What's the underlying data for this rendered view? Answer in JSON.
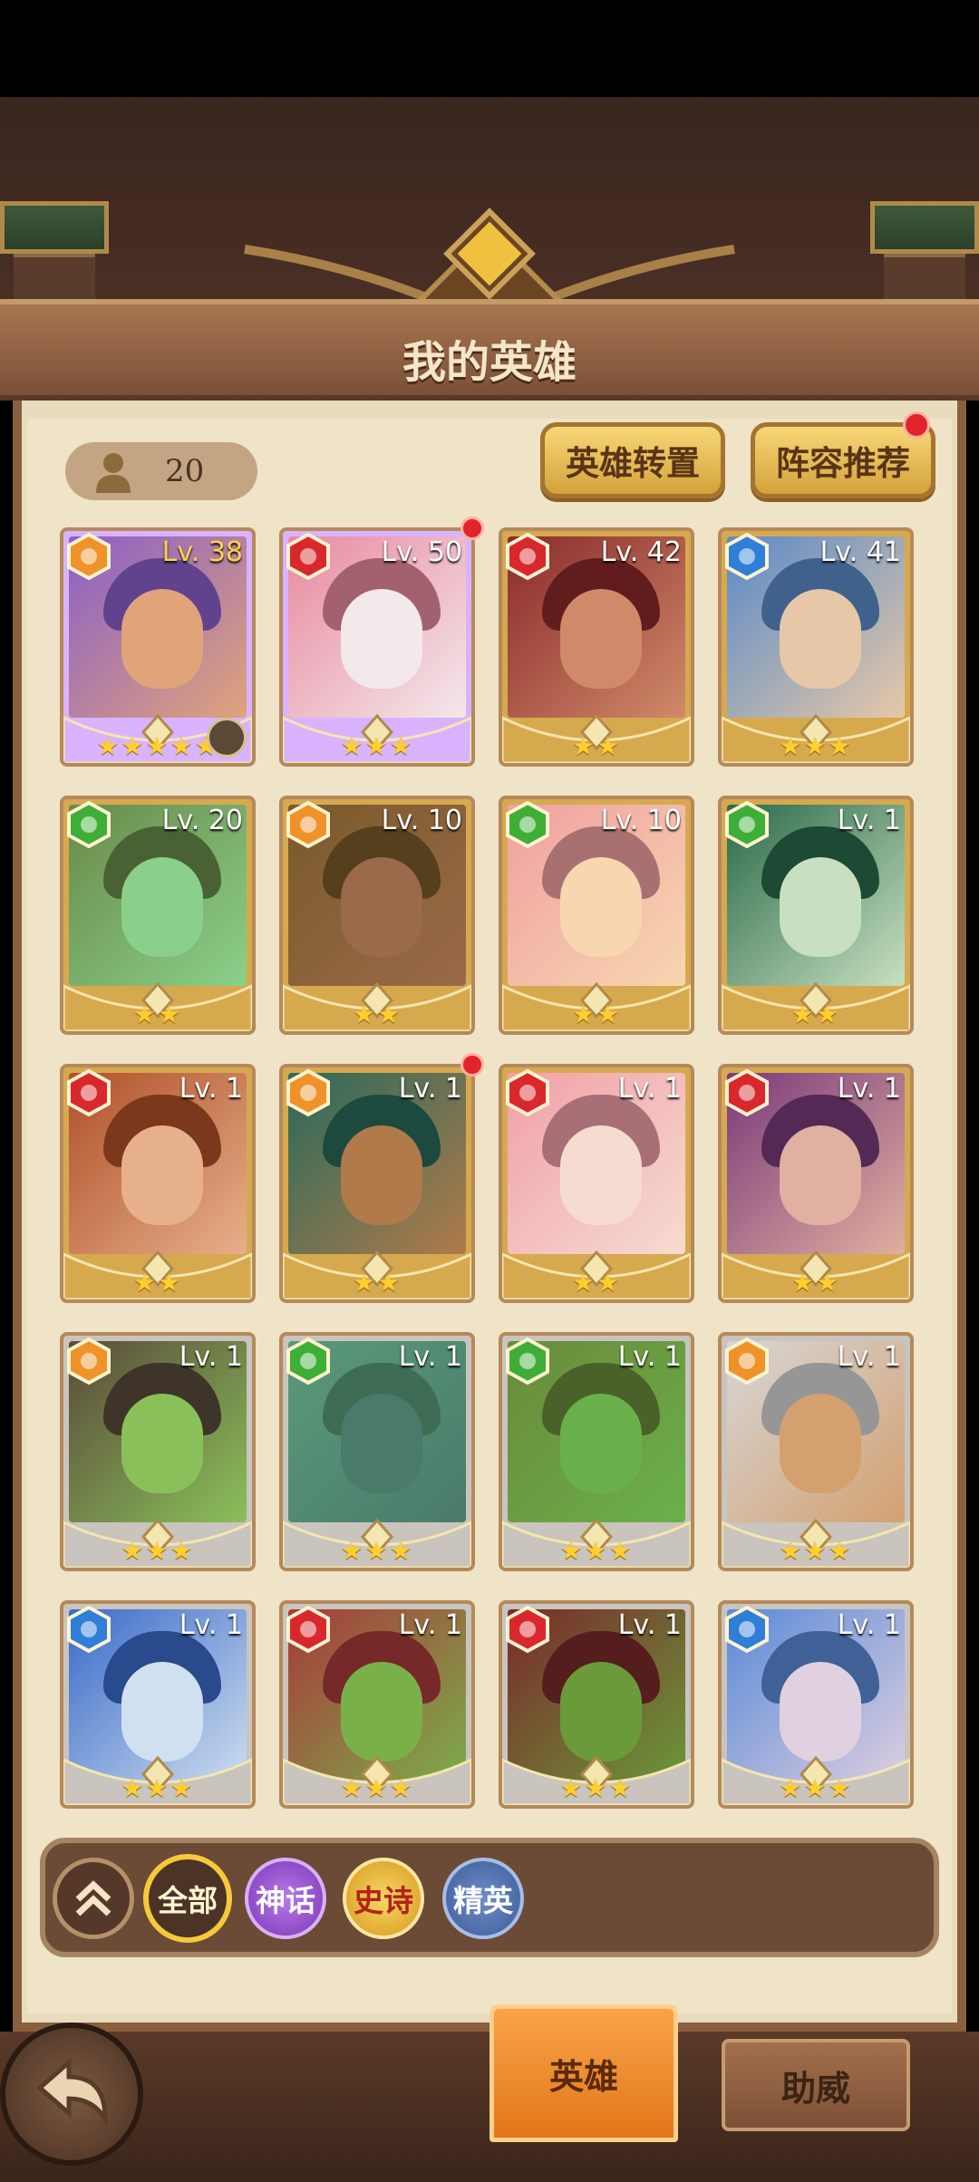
{
  "header": {
    "title": "我的英雄"
  },
  "toolbar": {
    "hero_count": "20",
    "transfer_label": "英雄转置",
    "lineup_label": "阵容推荐"
  },
  "colors": {
    "fire": "#d9282c",
    "light": "#f0922a",
    "nature": "#3fae37",
    "water": "#2f7ed8"
  },
  "heroes": [
    {
      "level": "Lv. 38",
      "element": "light",
      "stars": "★★★★★",
      "tier": "myth"
    },
    {
      "level": "Lv. 50",
      "element": "fire",
      "stars": "★★★",
      "tier": "myth"
    },
    {
      "level": "Lv. 42",
      "element": "fire",
      "stars": "★★",
      "tier": "epic"
    },
    {
      "level": "Lv. 41",
      "element": "water",
      "stars": "★★★",
      "tier": "epic"
    },
    {
      "level": "Lv. 20",
      "element": "nature",
      "stars": "★★",
      "tier": "epic"
    },
    {
      "level": "Lv. 10",
      "element": "light",
      "stars": "★★",
      "tier": "epic"
    },
    {
      "level": "Lv. 10",
      "element": "nature",
      "stars": "★★",
      "tier": "epic"
    },
    {
      "level": "Lv. 1",
      "element": "nature",
      "stars": "★★",
      "tier": "epic"
    },
    {
      "level": "Lv. 1",
      "element": "fire",
      "stars": "★★",
      "tier": "epic"
    },
    {
      "level": "Lv. 1",
      "element": "light",
      "stars": "★★",
      "tier": "epic"
    },
    {
      "level": "Lv. 1",
      "element": "fire",
      "stars": "★★",
      "tier": "epic"
    },
    {
      "level": "Lv. 1",
      "element": "fire",
      "stars": "★★",
      "tier": "epic"
    },
    {
      "level": "Lv. 1",
      "element": "light",
      "stars": "★★★",
      "tier": "elite"
    },
    {
      "level": "Lv. 1",
      "element": "nature",
      "stars": "★★★",
      "tier": "elite"
    },
    {
      "level": "Lv. 1",
      "element": "nature",
      "stars": "★★★",
      "tier": "elite"
    },
    {
      "level": "Lv. 1",
      "element": "light",
      "stars": "★★★",
      "tier": "elite"
    },
    {
      "level": "Lv. 1",
      "element": "water",
      "stars": "★★★",
      "tier": "elite"
    },
    {
      "level": "Lv. 1",
      "element": "fire",
      "stars": "★★★",
      "tier": "elite"
    },
    {
      "level": "Lv. 1",
      "element": "fire",
      "stars": "★★★",
      "tier": "elite"
    },
    {
      "level": "Lv. 1",
      "element": "water",
      "stars": "★★★",
      "tier": "elite"
    }
  ],
  "filters": {
    "all": "全部",
    "myth": "神话",
    "epic": "史诗",
    "elite": "精英"
  },
  "tabs": {
    "heroes": "英雄",
    "assist": "助威"
  }
}
